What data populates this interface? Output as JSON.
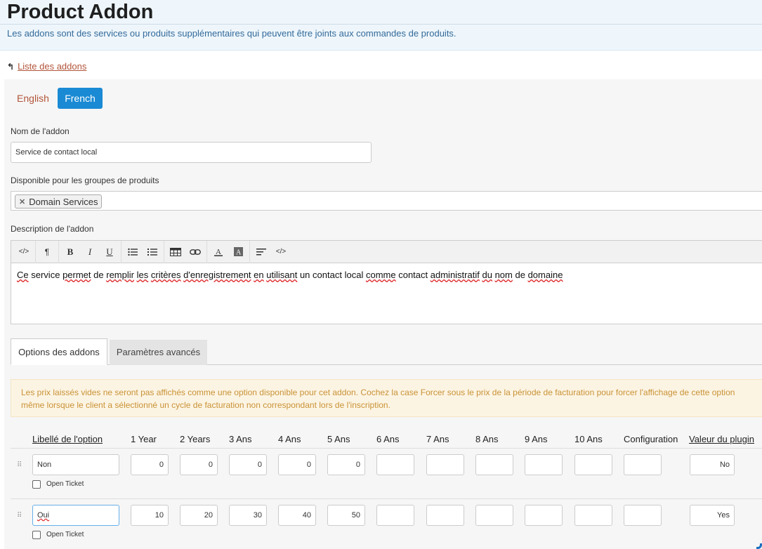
{
  "header": {
    "title": "Product Addon",
    "subtitle": "Les addons sont des services ou produits supplémentaires qui peuvent être joints aux commandes de produits."
  },
  "back_link": {
    "label": "Liste des addons",
    "icon": "arrow-up-left-icon"
  },
  "languages": {
    "english": "English",
    "french": "French",
    "active": "French"
  },
  "fields": {
    "name_label": "Nom de l'addon",
    "name_value": "Service de contact local",
    "groups_label": "Disponible pour les groupes de produits",
    "groups_tags": [
      "Domain Services"
    ],
    "description_label": "Description de l'addon",
    "description_words": [
      "Ce",
      "service",
      "permet",
      "de",
      "remplir",
      "les",
      "critères",
      "d'enregistrement",
      "en",
      "utilisant",
      "un",
      "contact",
      "local",
      "comme",
      "contact",
      "administratif",
      "du",
      "nom",
      "de",
      "domaine"
    ]
  },
  "toolbar": {
    "code": "</>",
    "paragraph": "¶",
    "bold": "B",
    "italic": "I",
    "underline": "U",
    "source": "</>"
  },
  "tabs": {
    "options": "Options des addons",
    "advanced": "Paramètres avancés"
  },
  "alert": "Les prix laissés vides ne seront pas affichés comme une option disponible pour cet addon. Cochez la case Forcer sous le prix de la période de facturation pour forcer l'affichage de cette option même lorsque le client a sélectionné un cycle de facturation non correspondant lors de l'inscription.",
  "table": {
    "headers": [
      "Libellé de l'option",
      "1 Year",
      "2 Years",
      "3 Ans",
      "4 Ans",
      "5 Ans",
      "6 Ans",
      "7 Ans",
      "8 Ans",
      "9 Ans",
      "10 Ans",
      "Configuration",
      "Valeur du plugin"
    ],
    "rows": [
      {
        "label": "Non",
        "prices": [
          "0",
          "0",
          "0",
          "0",
          "0",
          "",
          "",
          "",
          "",
          ""
        ],
        "config": "",
        "plugin": "No",
        "open_ticket": "Open Ticket"
      },
      {
        "label": "Oui",
        "prices": [
          "10",
          "20",
          "30",
          "40",
          "50",
          "",
          "",
          "",
          "",
          ""
        ],
        "config": "",
        "plugin": "Yes",
        "open_ticket": "Open Ticket"
      }
    ]
  }
}
